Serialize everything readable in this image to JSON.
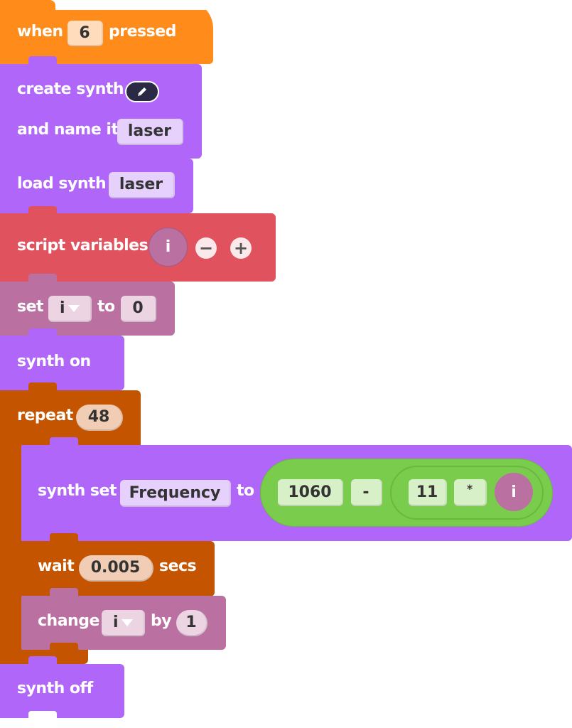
{
  "colors": {
    "events": "#ff8c1a",
    "synth": "#b066f9",
    "variables_red": "#e0525e",
    "variables": "#ba70a0",
    "control": "#c45400",
    "operators": "#79cc4c"
  },
  "blocks": {
    "when_pressed": {
      "label_when": "when",
      "key": "6",
      "label_pressed": "pressed"
    },
    "create_synth": {
      "label": "create synth",
      "icon": "pencil-icon",
      "label_name": "and name it",
      "name": "laser"
    },
    "load_synth": {
      "label": "load synth",
      "name": "laser"
    },
    "script_variables": {
      "label": "script variables",
      "var": "i",
      "minus": "−",
      "plus": "+"
    },
    "set_var": {
      "label_set": "set",
      "var": "i",
      "label_to": "to",
      "value": "0"
    },
    "synth_on": {
      "label": "synth on"
    },
    "repeat": {
      "label": "repeat",
      "count": "48"
    },
    "synth_set": {
      "label": "synth set",
      "param": "Frequency",
      "label_to": "to",
      "expr": {
        "a": "1060",
        "op1": "-",
        "b": "11",
        "op2": "*",
        "var": "i"
      }
    },
    "wait": {
      "label": "wait",
      "value": "0.005",
      "label_secs": "secs"
    },
    "change_var": {
      "label_change": "change",
      "var": "i",
      "label_by": "by",
      "value": "1"
    },
    "synth_off": {
      "label": "synth off"
    }
  }
}
